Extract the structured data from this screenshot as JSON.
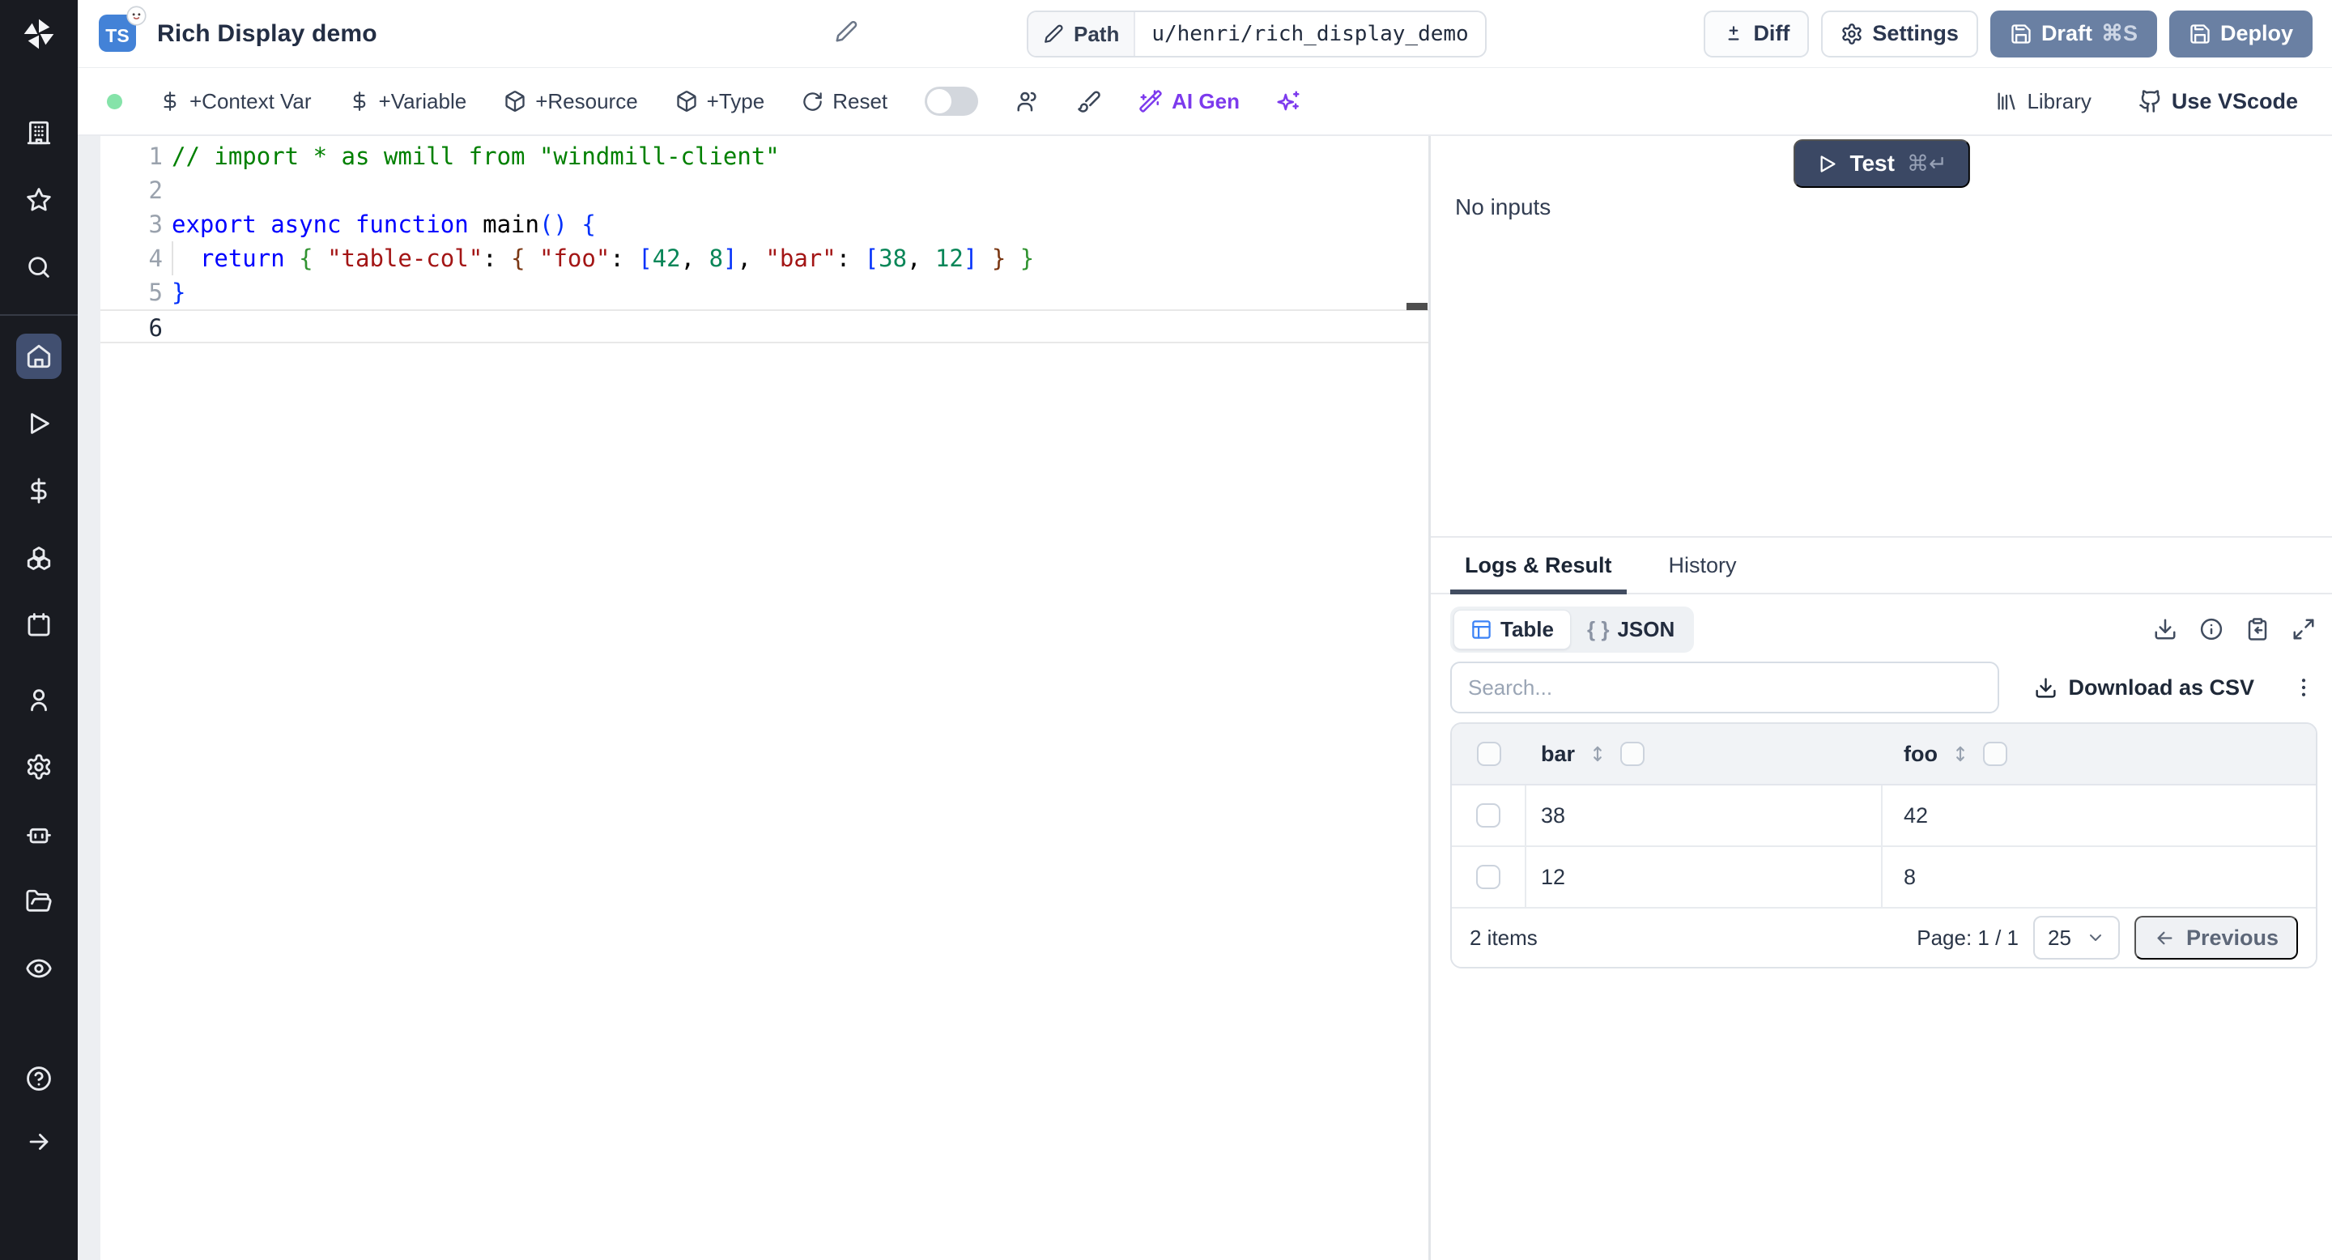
{
  "colors": {
    "accent_blue": "#3b82f6",
    "purple": "#7c3aed",
    "steel_button": "#6a80a3",
    "test_button": "#3b4864",
    "green_dot": "#85e3a9",
    "rail_bg": "#191b21",
    "rail_active": "#414f70"
  },
  "sidebar": {
    "items": [
      {
        "icon": "building-icon",
        "group": 1
      },
      {
        "icon": "star-icon",
        "group": 1
      },
      {
        "icon": "search-icon",
        "group": 1
      },
      {
        "icon": "home-icon",
        "group": 2,
        "active": true
      },
      {
        "icon": "play-icon",
        "group": 2
      },
      {
        "icon": "dollar-icon",
        "group": 2
      },
      {
        "icon": "boxes-icon",
        "group": 2
      },
      {
        "icon": "calendar-icon",
        "group": 2
      },
      {
        "icon": "user-icon",
        "group": 3
      },
      {
        "icon": "settings-icon",
        "group": 3
      },
      {
        "icon": "bot-icon",
        "group": 3
      },
      {
        "icon": "folder-open-icon",
        "group": 3
      },
      {
        "icon": "eye-icon",
        "group": 3
      },
      {
        "icon": "help-icon",
        "group": 4
      },
      {
        "icon": "arrow-right-icon",
        "group": 4
      }
    ]
  },
  "topbar": {
    "badge": "TS",
    "title": "Rich Display demo",
    "path_label": "Path",
    "path_value": "u/henri/rich_display_demo",
    "diff": "Diff",
    "settings": "Settings",
    "draft": "Draft",
    "draft_shortcut": "⌘S",
    "deploy": "Deploy"
  },
  "toolbar": {
    "context_var": "+Context Var",
    "variable": "+Variable",
    "resource": "+Resource",
    "type": "+Type",
    "reset": "Reset",
    "ai_gen": "AI Gen",
    "library": "Library",
    "vscode": "Use VScode"
  },
  "editor": {
    "lines": [
      {
        "n": "1",
        "tokens": [
          {
            "c": "comment",
            "t": "// import * as wmill from \"windmill-client\""
          }
        ]
      },
      {
        "n": "2",
        "tokens": []
      },
      {
        "n": "3",
        "tokens": [
          {
            "c": "kw",
            "t": "export async function "
          },
          {
            "c": "plain",
            "t": "main"
          },
          {
            "c": "b1",
            "t": "() {"
          }
        ]
      },
      {
        "n": "4",
        "tokens": [
          {
            "c": "plain",
            "t": "  "
          },
          {
            "c": "kw",
            "t": "return"
          },
          {
            "c": "plain",
            "t": " "
          },
          {
            "c": "b2",
            "t": "{"
          },
          {
            "c": "plain",
            "t": " "
          },
          {
            "c": "str",
            "t": "\"table-col\""
          },
          {
            "c": "plain",
            "t": ": "
          },
          {
            "c": "b3",
            "t": "{"
          },
          {
            "c": "plain",
            "t": " "
          },
          {
            "c": "str",
            "t": "\"foo\""
          },
          {
            "c": "plain",
            "t": ": "
          },
          {
            "c": "b1",
            "t": "["
          },
          {
            "c": "num",
            "t": "42"
          },
          {
            "c": "plain",
            "t": ", "
          },
          {
            "c": "num",
            "t": "8"
          },
          {
            "c": "b1",
            "t": "]"
          },
          {
            "c": "plain",
            "t": ", "
          },
          {
            "c": "str",
            "t": "\"bar\""
          },
          {
            "c": "plain",
            "t": ": "
          },
          {
            "c": "b1",
            "t": "["
          },
          {
            "c": "num",
            "t": "38"
          },
          {
            "c": "plain",
            "t": ", "
          },
          {
            "c": "num",
            "t": "12"
          },
          {
            "c": "b1",
            "t": "]"
          },
          {
            "c": "plain",
            "t": " "
          },
          {
            "c": "b3",
            "t": "}"
          },
          {
            "c": "plain",
            "t": " "
          },
          {
            "c": "b2",
            "t": "}"
          }
        ]
      },
      {
        "n": "5",
        "tokens": [
          {
            "c": "b1",
            "t": "}"
          }
        ]
      },
      {
        "n": "6",
        "tokens": [],
        "current": true
      }
    ]
  },
  "run": {
    "test_label": "Test",
    "shortcut": "⌘↵",
    "no_inputs": "No inputs"
  },
  "tabs": {
    "logs": "Logs & Result",
    "history": "History"
  },
  "result_views": {
    "table": "Table",
    "json_icon": "{ }",
    "json": "JSON"
  },
  "search": {
    "placeholder": "Search...",
    "download_csv": "Download as CSV"
  },
  "table": {
    "columns": [
      "bar",
      "foo"
    ],
    "rows": [
      [
        "38",
        "42"
      ],
      [
        "12",
        "8"
      ]
    ],
    "footer": {
      "count": "2 items",
      "page": "Page: 1 / 1",
      "page_size": "25",
      "previous": "Previous"
    }
  }
}
